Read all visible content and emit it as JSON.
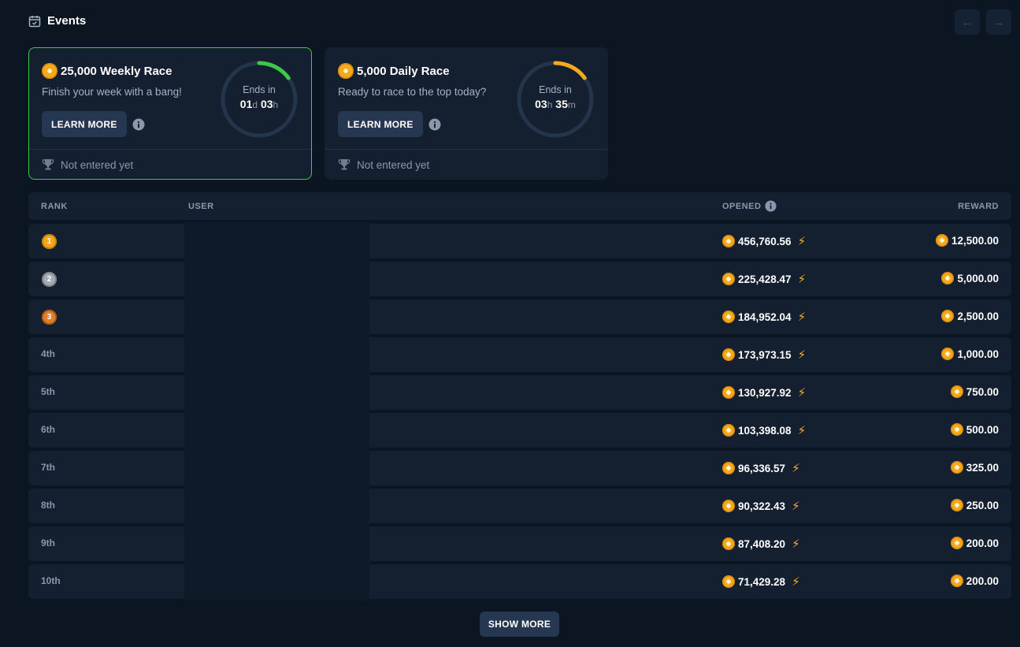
{
  "header": {
    "title": "Events"
  },
  "events": [
    {
      "title": "25,000 Weekly Race",
      "subtitle": "Finish your week with a bang!",
      "learn_more": "LEARN MORE",
      "ends_label": "Ends in",
      "time_a": "01",
      "unit_a": "d",
      "time_b": "03",
      "unit_b": "h",
      "status": "Not entered yet",
      "ring_color": "#3ec94a",
      "ring_progress": 0.15
    },
    {
      "title": "5,000 Daily Race",
      "subtitle": "Ready to race to the top today?",
      "learn_more": "LEARN MORE",
      "ends_label": "Ends in",
      "time_a": "03",
      "unit_a": "h",
      "time_b": "35",
      "unit_b": "m",
      "status": "Not entered yet",
      "ring_color": "#f5a91c",
      "ring_progress": 0.15
    }
  ],
  "table": {
    "headers": {
      "rank": "RANK",
      "user": "USER",
      "opened": "OPENED",
      "reward": "REWARD"
    },
    "rows": [
      {
        "rank": "1",
        "medal": "gold",
        "opened": "456,760.56",
        "reward": "12,500.00"
      },
      {
        "rank": "2",
        "medal": "silver",
        "opened": "225,428.47",
        "reward": "5,000.00"
      },
      {
        "rank": "3",
        "medal": "bronze",
        "opened": "184,952.04",
        "reward": "2,500.00"
      },
      {
        "rank": "4th",
        "opened": "173,973.15",
        "reward": "1,000.00"
      },
      {
        "rank": "5th",
        "opened": "130,927.92",
        "reward": "750.00"
      },
      {
        "rank": "6th",
        "opened": "103,398.08",
        "reward": "500.00"
      },
      {
        "rank": "7th",
        "opened": "96,336.57",
        "reward": "325.00"
      },
      {
        "rank": "8th",
        "opened": "90,322.43",
        "reward": "250.00"
      },
      {
        "rank": "9th",
        "opened": "87,408.20",
        "reward": "200.00"
      },
      {
        "rank": "10th",
        "opened": "71,429.28",
        "reward": "200.00"
      }
    ]
  },
  "show_more": "SHOW MORE"
}
